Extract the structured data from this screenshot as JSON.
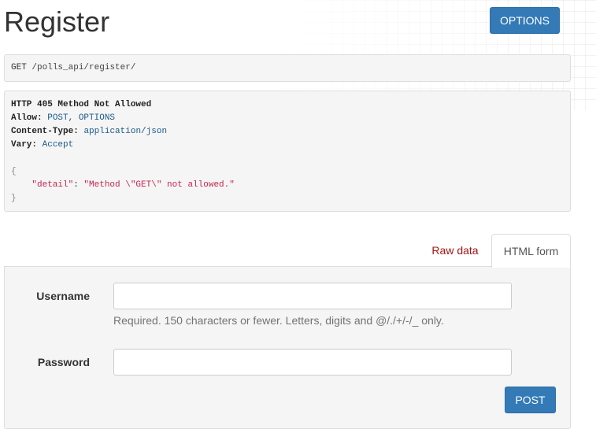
{
  "page": {
    "title": "Register",
    "options_label": "OPTIONS"
  },
  "request": {
    "method": "GET",
    "path_prefix": "/polls_api/",
    "path_tail": "register",
    "path_suffix": "/"
  },
  "response": {
    "status": "HTTP 405 Method Not Allowed",
    "headers": [
      {
        "key": "Allow:",
        "value": "POST, OPTIONS"
      },
      {
        "key": "Content-Type:",
        "value": "application/json"
      },
      {
        "key": "Vary:",
        "value": "Accept"
      }
    ],
    "body_open": "{",
    "body_key": "\"detail\"",
    "body_colon": ": ",
    "body_value": "\"Method \\\"GET\\\" not allowed.\"",
    "body_close": "}"
  },
  "tabs": {
    "raw_data": "Raw data",
    "html_form": "HTML form"
  },
  "form": {
    "username_label": "Username",
    "username_value": "",
    "username_help": "Required. 150 characters or fewer. Letters, digits and @/./+/-/_ only.",
    "password_label": "Password",
    "password_value": "",
    "submit_label": "POST"
  },
  "colors": {
    "primary": "#337ab7",
    "raw_tab": "#a31515",
    "json_string": "#c7254e"
  }
}
